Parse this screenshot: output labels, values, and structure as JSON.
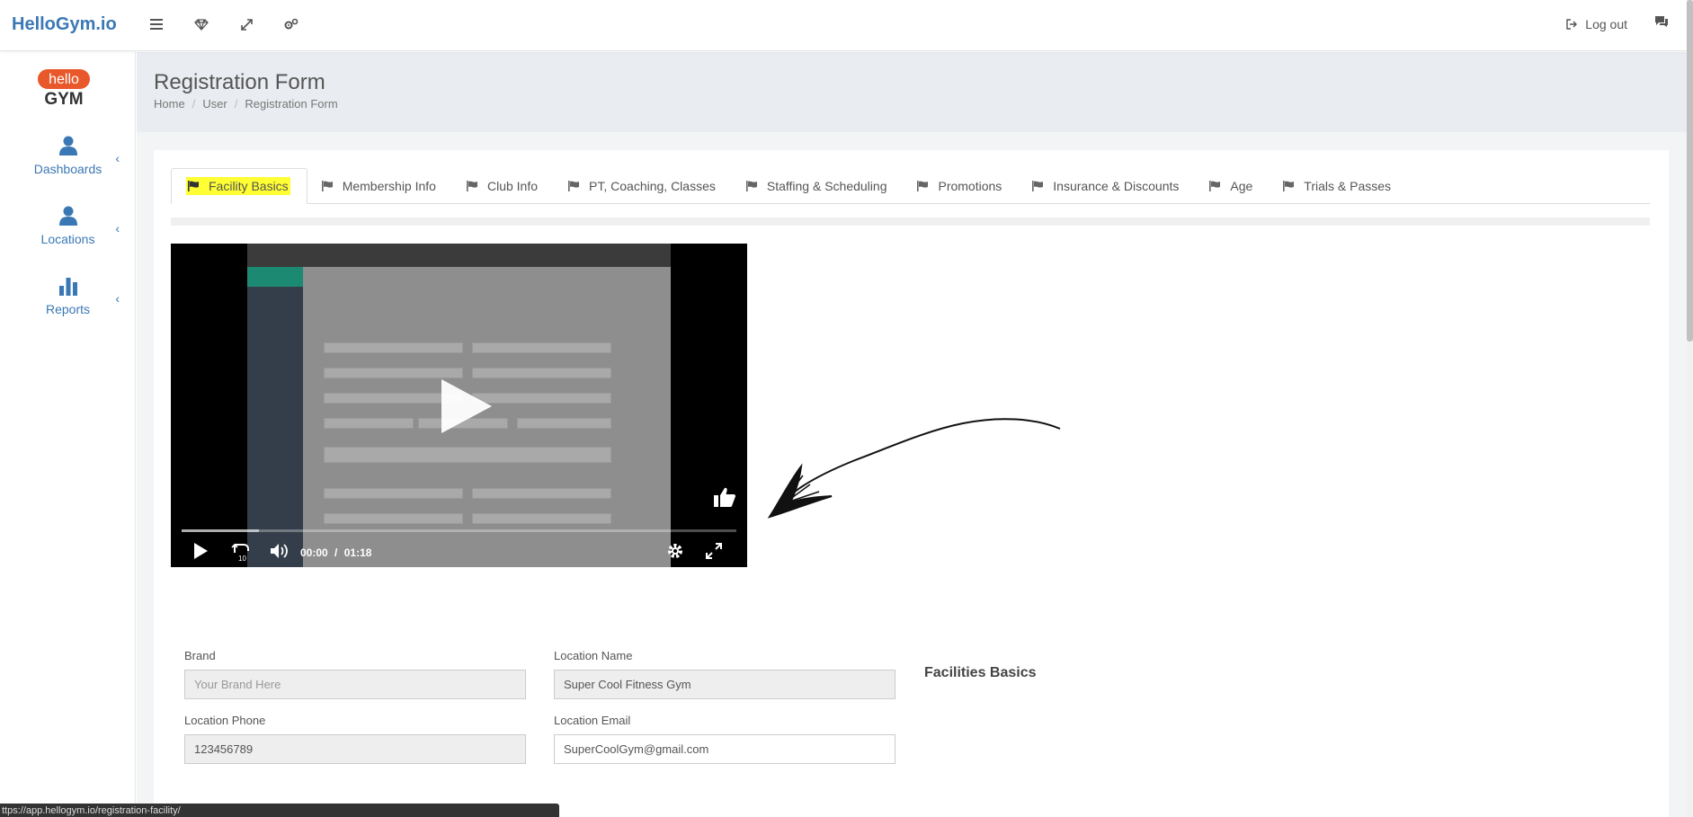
{
  "header": {
    "brand": "HelloGym.io",
    "icons": [
      "menu-icon",
      "diamond-icon",
      "expand-icon",
      "settings-icon"
    ],
    "logout_label": "Log out"
  },
  "sidebar": {
    "logo_top": "hello",
    "logo_bottom": "GYM",
    "items": [
      {
        "label": "Dashboards",
        "icon": "user-icon"
      },
      {
        "label": "Locations",
        "icon": "user-icon"
      },
      {
        "label": "Reports",
        "icon": "bar-chart-icon"
      }
    ]
  },
  "page": {
    "title": "Registration Form",
    "breadcrumb": [
      "Home",
      "User",
      "Registration Form"
    ]
  },
  "tabs": [
    {
      "label": "Facility Basics",
      "active": true
    },
    {
      "label": "Membership Info"
    },
    {
      "label": "Club Info"
    },
    {
      "label": "PT, Coaching, Classes"
    },
    {
      "label": "Staffing & Scheduling"
    },
    {
      "label": "Promotions"
    },
    {
      "label": "Insurance & Discounts"
    },
    {
      "label": "Age"
    },
    {
      "label": "Trials & Passes"
    }
  ],
  "video": {
    "current_time": "00:00",
    "separator": "/",
    "duration": "01:18",
    "progress": 0.14
  },
  "form": {
    "brand_label": "Brand",
    "brand_placeholder": "Your Brand Here",
    "location_name_label": "Location Name",
    "location_name_value": "Super Cool Fitness Gym",
    "section_title": "Facilities Basics",
    "location_phone_label": "Location Phone",
    "location_phone_value": "123456789",
    "location_email_label": "Location Email",
    "location_email_value": "SuperCoolGym@gmail.com"
  },
  "statusbar": {
    "url": "ttps://app.hellogym.io/registration-facility/"
  },
  "colors": {
    "accent": "#3a78b5",
    "highlight": "#ffff33"
  }
}
